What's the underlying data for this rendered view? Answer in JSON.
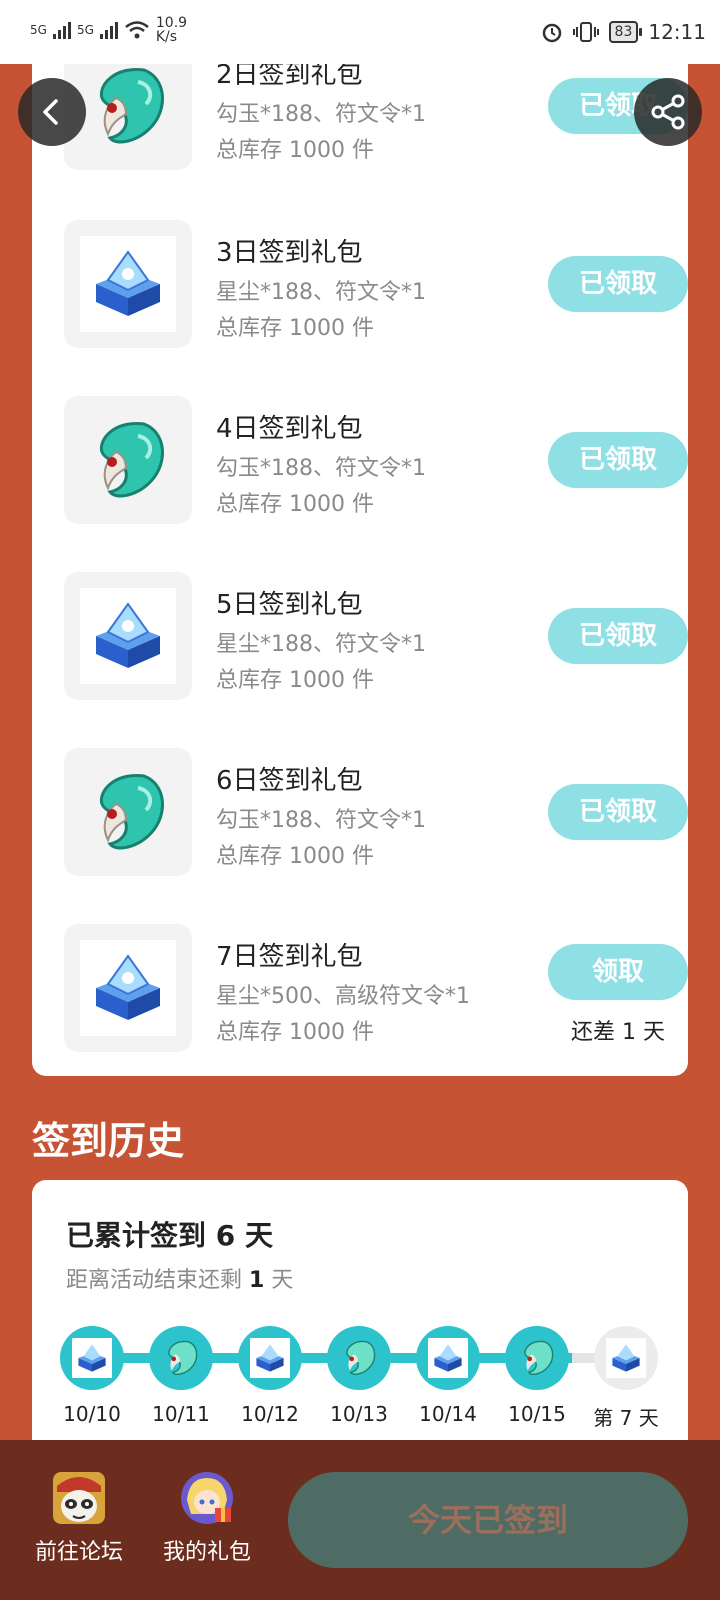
{
  "status_bar": {
    "net_type_1": "5G",
    "net_type_2": "5G",
    "net_speed": "10.9",
    "net_speed_unit": "K/s",
    "battery": "83",
    "time": "12:11"
  },
  "gifts": [
    {
      "title": "2日签到礼包",
      "desc": "勾玉*188、符文令*1",
      "stock": "总库存 1000 件",
      "button": "已领取",
      "icon": "magatama-icon"
    },
    {
      "title": "3日签到礼包",
      "desc": "星尘*188、符文令*1",
      "stock": "总库存 1000 件",
      "button": "已领取",
      "icon": "stardust-chest-icon"
    },
    {
      "title": "4日签到礼包",
      "desc": "勾玉*188、符文令*1",
      "stock": "总库存 1000 件",
      "button": "已领取",
      "icon": "magatama-icon"
    },
    {
      "title": "5日签到礼包",
      "desc": "星尘*188、符文令*1",
      "stock": "总库存 1000 件",
      "button": "已领取",
      "icon": "stardust-chest-icon"
    },
    {
      "title": "6日签到礼包",
      "desc": "勾玉*188、符文令*1",
      "stock": "总库存 1000 件",
      "button": "已领取",
      "icon": "magatama-icon"
    },
    {
      "title": "7日签到礼包",
      "desc": "星尘*500、高级符文令*1",
      "stock": "总库存 1000 件",
      "button": "领取",
      "remain": "还差 1 天",
      "icon": "stardust-chest-icon"
    }
  ],
  "history": {
    "heading": "签到历史",
    "summary": "已累计签到 6 天",
    "remaining_prefix": "距离活动结束还剩",
    "remaining_days": "1",
    "remaining_suffix": "天",
    "timeline": [
      {
        "date": "10/10",
        "icon": "stardust-chest-icon",
        "done": true
      },
      {
        "date": "10/11",
        "icon": "magatama-icon",
        "done": true
      },
      {
        "date": "10/12",
        "icon": "stardust-chest-icon",
        "done": true
      },
      {
        "date": "10/13",
        "icon": "magatama-icon",
        "done": true
      },
      {
        "date": "10/14",
        "icon": "stardust-chest-icon",
        "done": true
      },
      {
        "date": "10/15",
        "icon": "magatama-icon",
        "done": true
      },
      {
        "date": "第 7 天",
        "icon": "stardust-chest-icon",
        "done": false
      }
    ]
  },
  "bottom": {
    "forum_label": "前往论坛",
    "gifts_label": "我的礼包",
    "checkin_label": "今天已签到"
  },
  "colors": {
    "page_bg": "#c65334",
    "claimed_button": "#8fe0e4",
    "timeline_accent": "#2cc3cc",
    "bottom_bar": "#6c2d1e",
    "checkin_button": "#4e6c63"
  }
}
